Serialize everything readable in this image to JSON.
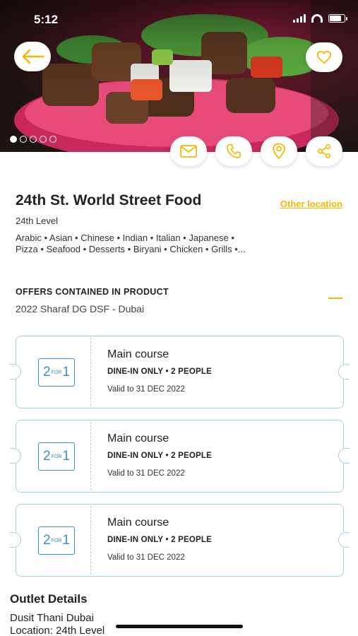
{
  "status_bar": {
    "time": "5:12"
  },
  "hero": {
    "image_desc_icon": "food-photo",
    "carousel": {
      "count": 5,
      "active": 0
    }
  },
  "restaurant": {
    "name": "24th St. World Street Food",
    "other_location_label": "Other location",
    "level": "24th Level",
    "cuisines_line1": "Arabic • Asian • Chinese • Indian • Italian • Japanese •",
    "cuisines_line2": "Pizza • Seafood • Desserts • Biryani • Chicken • Grills •..."
  },
  "offers": {
    "heading": "OFFERS CONTAINED IN PRODUCT",
    "product": "2022 Sharaf DG DSF - Dubai",
    "items": [
      {
        "badge_num": "2",
        "badge_for": "FOR",
        "badge_num2": "1",
        "title": "Main course",
        "dine": "DINE-IN ONLY • 2 PEOPLE",
        "valid": "Valid to 31 DEC 2022"
      },
      {
        "badge_num": "2",
        "badge_for": "FOR",
        "badge_num2": "1",
        "title": "Main course",
        "dine": "DINE-IN ONLY • 2 PEOPLE",
        "valid": "Valid to 31 DEC 2022"
      },
      {
        "badge_num": "2",
        "badge_for": "FOR",
        "badge_num2": "1",
        "title": "Main course",
        "dine": "DINE-IN ONLY • 2 PEOPLE",
        "valid": "Valid to 31 DEC 2022"
      }
    ]
  },
  "outlet": {
    "heading": "Outlet Details",
    "name": "Dusit Thani Dubai",
    "location": "Location: 24th Level"
  },
  "colors": {
    "accent": "#f5b800",
    "coupon_border": "#a9cfe8",
    "badge_blue": "#3a8fc8"
  }
}
